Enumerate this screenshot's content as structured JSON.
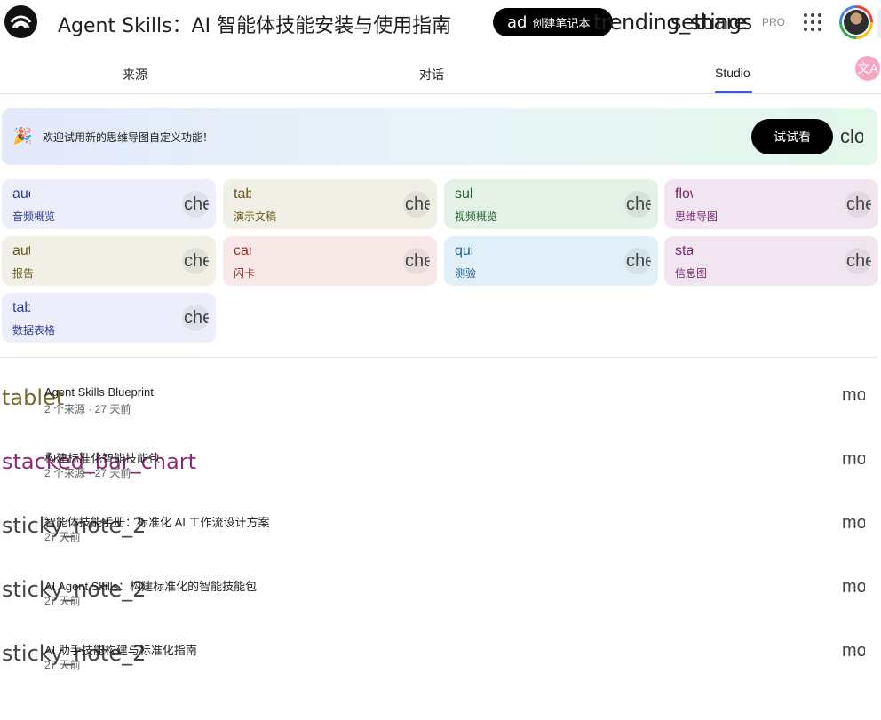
{
  "header": {
    "title": "Agent Skills：AI 智能体技能安装与使用指南",
    "create_button": {
      "ligature": "ad",
      "label": "创建笔记本"
    },
    "share_ligature": "trending_share",
    "settings_ligature": "settings",
    "pro_label": "PRO",
    "apps_icon": "apps-grid-icon",
    "avatar_icon": "user-avatar-icon"
  },
  "tabs": [
    {
      "label": "来源"
    },
    {
      "label": "对话"
    },
    {
      "label": "Studio",
      "active": true
    }
  ],
  "translate_icon": "文A",
  "banner": {
    "icon": "🎉",
    "text": "欢迎试用新的思维导图自定义功能！",
    "try_label": "试试看",
    "close_ligature": "close"
  },
  "tiles": [
    {
      "icon": "audio_magic_eraser",
      "label": "音频概览",
      "edit": "chevron_forward",
      "bg": "#eceffb",
      "fg": "#2b3d9a"
    },
    {
      "icon": "tablet",
      "label": "演示文稿",
      "edit": "chevron_forward",
      "bg": "#f1f0e6",
      "fg": "#6b5a1a"
    },
    {
      "icon": "subscriptions",
      "label": "视频概览",
      "edit": "chevron_forward",
      "bg": "#e4f1e7",
      "fg": "#1d5e2c"
    },
    {
      "icon": "flowchart",
      "label": "思维导图",
      "edit": "chevron_forward",
      "bg": "#f1e6f0",
      "fg": "#7a2470"
    },
    {
      "icon": "auto_tab_group",
      "label": "报告",
      "edit": "chevron_forward",
      "bg": "#f1f0e6",
      "fg": "#6b5a1a"
    },
    {
      "icon": "cards",
      "label": "闪卡",
      "edit": "chevron_forward",
      "bg": "#f8e9e8",
      "fg": "#9c2b22"
    },
    {
      "icon": "quiz",
      "label": "测验",
      "edit": "chevron_forward",
      "bg": "#e1f0f8",
      "fg": "#1c5e86"
    },
    {
      "icon": "stacked_bar_chart",
      "label": "信息图",
      "edit": "chevron_forward",
      "bg": "#f1e6f0",
      "fg": "#7a2470"
    },
    {
      "icon": "table_view",
      "label": "数据表格",
      "edit": "chevron_forward",
      "bg": "#eceffb",
      "fg": "#2b3d9a"
    }
  ],
  "notes": [
    {
      "icon": "tablet",
      "icon_color": "#7a6a26",
      "title": "Agent Skills Blueprint",
      "meta": "2 个来源 · 27 天前",
      "more": "more_vert"
    },
    {
      "icon": "stacked_bar_chart",
      "icon_color": "#8a2c7a",
      "title": "构建标准化智能技能包",
      "meta": "2 个来源 · 27 天前",
      "more": "more_vert"
    },
    {
      "icon": "sticky_note_2",
      "icon_color": "#444746",
      "title": "智能体技能手册：标准化 AI 工作流设计方案",
      "meta": "27 天前",
      "more": "more_vert"
    },
    {
      "icon": "sticky_note_2",
      "icon_color": "#444746",
      "title": "AI Agent Skills：构建标准化的智能技能包",
      "meta": "27 天前",
      "more": "more_vert"
    },
    {
      "icon": "sticky_note_2",
      "icon_color": "#444746",
      "title": "AI 助手技能构建与标准化指南",
      "meta": "27 天前",
      "more": "more_vert"
    }
  ]
}
